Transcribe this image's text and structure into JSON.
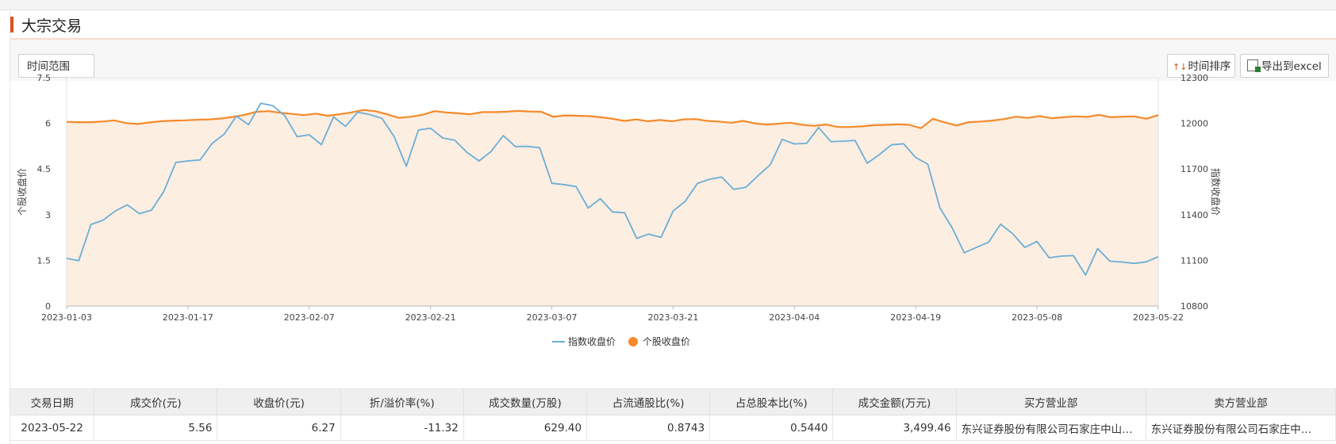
{
  "window": {
    "title": "大宗交易"
  },
  "toolbar": {
    "range_label": "时间范围",
    "sort_label": "时间排序",
    "export_label": "导出到excel"
  },
  "colors": {
    "index_line": "#6baed6",
    "stock_line": "#f58a2a",
    "stock_fill": "#fdeee2",
    "accent": "#d9531e"
  },
  "chart_data": {
    "type": "line",
    "x_ticks": [
      "2023-01-03",
      "2023-01-17",
      "2023-02-07",
      "2023-02-21",
      "2023-03-07",
      "2023-03-21",
      "2023-04-04",
      "2023-04-19",
      "2023-05-08",
      "2023-05-22"
    ],
    "y_left": {
      "label": "个股收盘价",
      "ticks": [
        "0",
        "1.5",
        "3",
        "4.5",
        "6",
        "7.5"
      ],
      "range": [
        0,
        7.5
      ]
    },
    "y_right": {
      "label": "指数收盘价",
      "ticks": [
        "10800",
        "11100",
        "11400",
        "11700",
        "12000",
        "12300"
      ],
      "range": [
        10800,
        12300
      ]
    },
    "legend": [
      "指数收盘价",
      "个股收盘价"
    ],
    "legend_position": "bottom-center",
    "series": [
      {
        "name": "个股收盘价",
        "axis": "left",
        "area": true,
        "values": [
          6.05,
          6.04,
          6.04,
          6.06,
          6.1,
          6.01,
          5.98,
          6.03,
          6.07,
          6.09,
          6.1,
          6.12,
          6.13,
          6.16,
          6.21,
          6.28,
          6.38,
          6.4,
          6.35,
          6.31,
          6.27,
          6.32,
          6.25,
          6.3,
          6.36,
          6.44,
          6.4,
          6.3,
          6.18,
          6.22,
          6.28,
          6.4,
          6.36,
          6.33,
          6.3,
          6.37,
          6.37,
          6.38,
          6.41,
          6.39,
          6.38,
          6.22,
          6.26,
          6.25,
          6.24,
          6.2,
          6.15,
          6.08,
          6.13,
          6.07,
          6.11,
          6.07,
          6.13,
          6.14,
          6.08,
          6.06,
          6.02,
          6.08,
          6.0,
          5.96,
          5.99,
          6.02,
          5.95,
          5.92,
          5.96,
          5.88,
          5.88,
          5.9,
          5.94,
          5.95,
          5.97,
          5.95,
          5.84,
          6.15,
          6.03,
          5.93,
          6.04,
          6.06,
          6.09,
          6.14,
          6.22,
          6.18,
          6.24,
          6.17,
          6.2,
          6.23,
          6.21,
          6.28,
          6.2,
          6.22,
          6.23,
          6.15,
          6.27
        ]
      },
      {
        "name": "指数收盘价",
        "axis": "right",
        "values": [
          11113,
          11098,
          11336,
          11364,
          11424,
          11465,
          11407,
          11430,
          11551,
          11743,
          11753,
          11760,
          11869,
          11930,
          12048,
          11991,
          12132,
          12116,
          12049,
          11913,
          11925,
          11860,
          12042,
          11980,
          12073,
          12058,
          12033,
          11913,
          11718,
          11956,
          11968,
          11904,
          11889,
          11810,
          11753,
          11816,
          11920,
          11848,
          11849,
          11840,
          11606,
          11598,
          11585,
          11444,
          11505,
          11418,
          11413,
          11245,
          11273,
          11251,
          11424,
          11488,
          11605,
          11633,
          11648,
          11566,
          11580,
          11656,
          11727,
          11895,
          11865,
          11868,
          11973,
          11880,
          11883,
          11888,
          11738,
          11795,
          11859,
          11866,
          11776,
          11732,
          11444,
          11315,
          11150,
          11185,
          11219,
          11338,
          11275,
          11185,
          11224,
          11117,
          11128,
          11131,
          11003,
          11178,
          11095,
          11089,
          11080,
          11090,
          11124
        ]
      }
    ]
  },
  "table": {
    "columns": [
      "交易日期",
      "成交价(元)",
      "收盘价(元)",
      "折/溢价率(%)",
      "成交数量(万股)",
      "占流通股比(%)",
      "占总股本比(%)",
      "成交金额(万元)",
      "买方营业部",
      "卖方营业部"
    ],
    "rows": [
      [
        "2023-05-22",
        "5.56",
        "6.27",
        "-11.32",
        "629.40",
        "0.8743",
        "0.5440",
        "3,499.46",
        "东兴证券股份有限公司石家庄中山…",
        "东兴证券股份有限公司石家庄中…"
      ]
    ]
  }
}
